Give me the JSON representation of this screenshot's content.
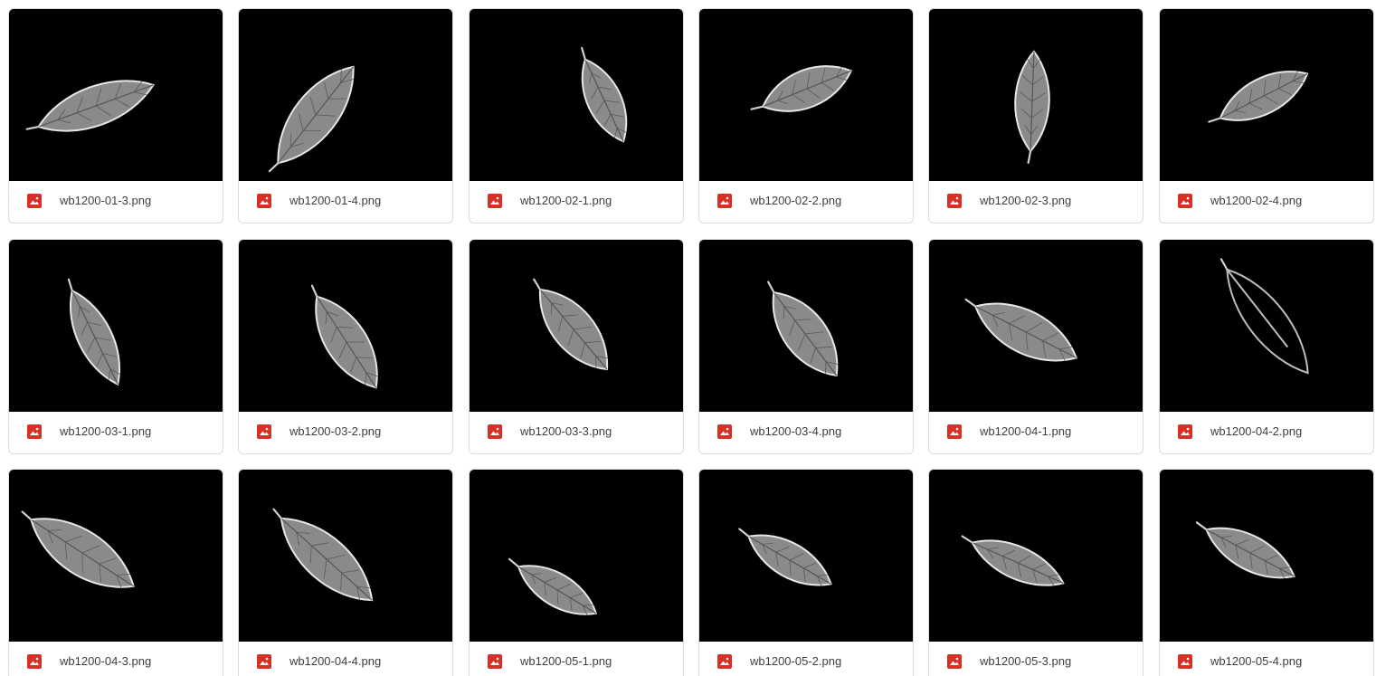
{
  "icon": "image-file-icon",
  "icon_color": "#d93025",
  "files": [
    {
      "name": "wb1200-01-3.png"
    },
    {
      "name": "wb1200-01-4.png"
    },
    {
      "name": "wb1200-02-1.png"
    },
    {
      "name": "wb1200-02-2.png"
    },
    {
      "name": "wb1200-02-3.png"
    },
    {
      "name": "wb1200-02-4.png"
    },
    {
      "name": "wb1200-03-1.png"
    },
    {
      "name": "wb1200-03-2.png"
    },
    {
      "name": "wb1200-03-3.png"
    },
    {
      "name": "wb1200-03-4.png"
    },
    {
      "name": "wb1200-04-1.png"
    },
    {
      "name": "wb1200-04-2.png"
    },
    {
      "name": "wb1200-04-3.png"
    },
    {
      "name": "wb1200-04-4.png"
    },
    {
      "name": "wb1200-05-1.png"
    },
    {
      "name": "wb1200-05-2.png"
    },
    {
      "name": "wb1200-05-3.png"
    },
    {
      "name": "wb1200-05-4.png"
    }
  ]
}
